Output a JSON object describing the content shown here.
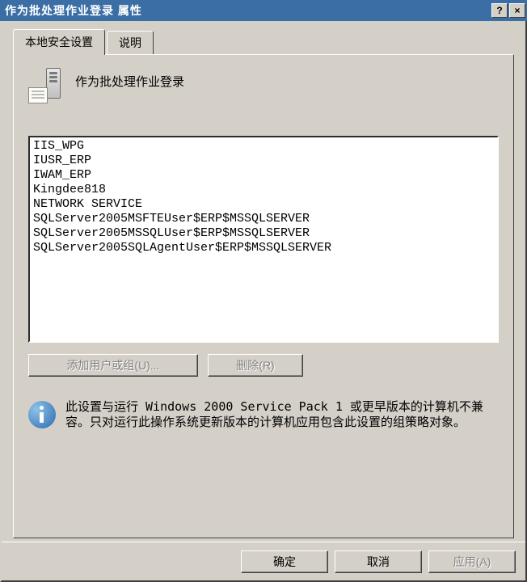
{
  "window": {
    "title": "作为批处理作业登录 属性",
    "help_hint": "?",
    "close_hint": "×"
  },
  "tabs": {
    "local": "本地安全设置",
    "desc": "说明"
  },
  "policy": {
    "name": "作为批处理作业登录"
  },
  "users": [
    "IIS_WPG",
    "IUSR_ERP",
    "IWAM_ERP",
    "Kingdee818",
    "NETWORK SERVICE",
    "SQLServer2005MSFTEUser$ERP$MSSQLSERVER",
    "SQLServer2005MSSQLUser$ERP$MSSQLSERVER",
    "SQLServer2005SQLAgentUser$ERP$MSSQLSERVER"
  ],
  "buttons": {
    "add": "添加用户或组(U)...",
    "remove": "删除(R)",
    "ok": "确定",
    "cancel": "取消",
    "apply": "应用(A)"
  },
  "info": {
    "text": "此设置与运行 Windows 2000 Service Pack 1 或更早版本的计算机不兼容。只对运行此操作系统更新版本的计算机应用包含此设置的组策略对象。"
  }
}
